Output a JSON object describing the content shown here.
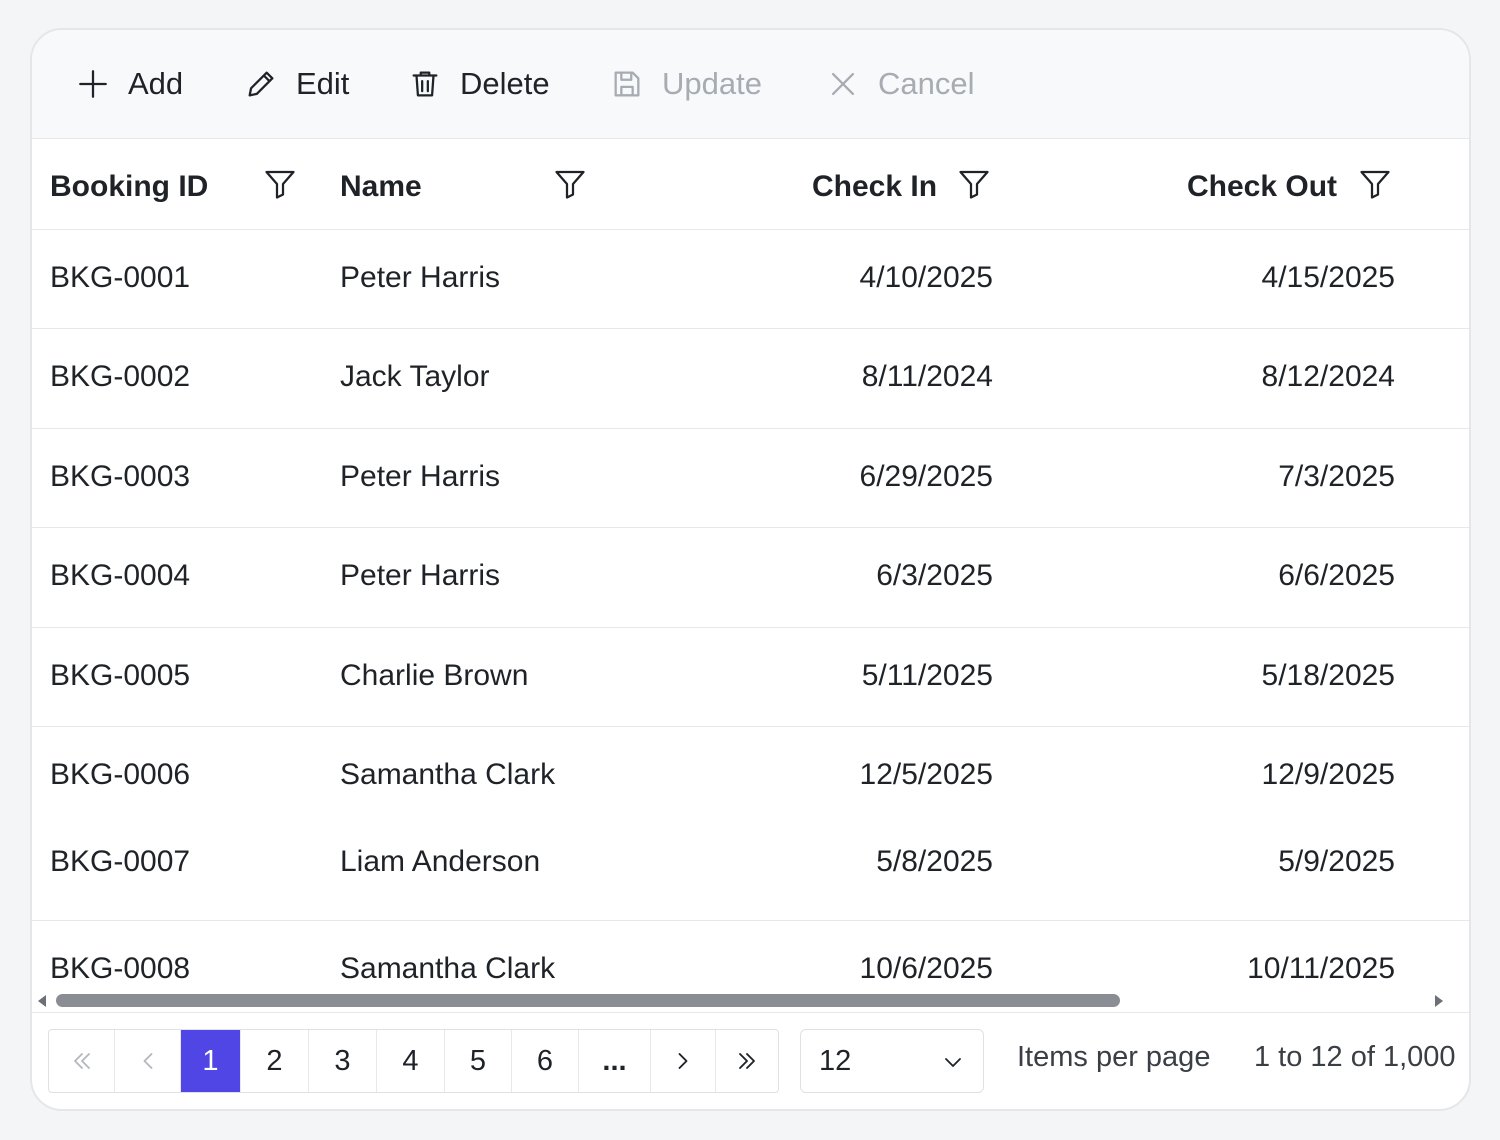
{
  "toolbar": {
    "add": "Add",
    "edit": "Edit",
    "delete": "Delete",
    "update": "Update",
    "cancel": "Cancel"
  },
  "columns": {
    "booking_id": "Booking ID",
    "name": "Name",
    "check_in": "Check In",
    "check_out": "Check Out"
  },
  "rows": [
    {
      "id": "BKG-0001",
      "name": "Peter Harris",
      "check_in": "4/10/2025",
      "check_out": "4/15/2025"
    },
    {
      "id": "BKG-0002",
      "name": "Jack Taylor",
      "check_in": "8/11/2024",
      "check_out": "8/12/2024"
    },
    {
      "id": "BKG-0003",
      "name": "Peter Harris",
      "check_in": "6/29/2025",
      "check_out": "7/3/2025"
    },
    {
      "id": "BKG-0004",
      "name": "Peter Harris",
      "check_in": "6/3/2025",
      "check_out": "6/6/2025"
    },
    {
      "id": "BKG-0005",
      "name": "Charlie Brown",
      "check_in": "5/11/2025",
      "check_out": "5/18/2025"
    },
    {
      "id": "BKG-0006",
      "name": "Samantha Clark",
      "check_in": "12/5/2025",
      "check_out": "12/9/2025"
    },
    {
      "id": "BKG-0007",
      "name": "Liam Anderson",
      "check_in": "5/8/2025",
      "check_out": "5/9/2025"
    },
    {
      "id": "BKG-0008",
      "name": "Samantha Clark",
      "check_in": "10/6/2025",
      "check_out": "10/11/2025"
    }
  ],
  "pager": {
    "pages": [
      "1",
      "2",
      "3",
      "4",
      "5",
      "6"
    ],
    "ellipsis": "...",
    "current_page": "1",
    "page_size": "12",
    "items_per_page_label": "Items per page",
    "range_label": "1 to 12 of 1,000"
  },
  "colors": {
    "accent": "#4f46e5",
    "toolbar_bg": "#f7f9fb",
    "disabled_text": "#a7abb2"
  },
  "icons": {
    "add": "plus-icon",
    "edit": "pencil-icon",
    "delete": "trash-icon",
    "update": "save-icon",
    "cancel": "close-icon",
    "filter": "filter-icon"
  }
}
